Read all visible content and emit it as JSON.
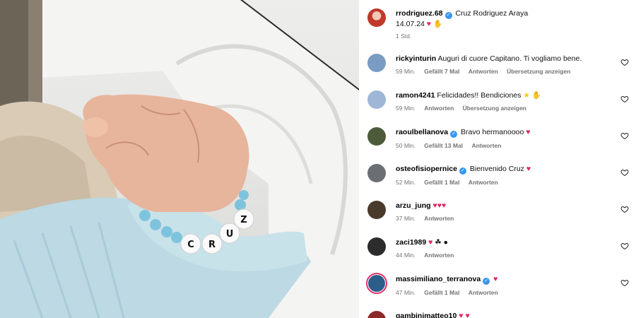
{
  "post": {
    "author": "rrodriguez.68",
    "caption": "Cruz Rodriguez Araya",
    "date_line": "14.07.24 ♥",
    "time": "1 Std.",
    "bracelet_text": "CRUZ"
  },
  "comments": [
    {
      "user": "rickyinturin",
      "verified": false,
      "text": "Auguri di cuore Capitano. Ti vogliamo bene.",
      "time": "59 Min.",
      "likes": "Gefällt 7 Mal",
      "reply": "Antworten",
      "translate": "Übersetzung anzeigen",
      "avatar_color": "#7a9cc4"
    },
    {
      "user": "ramon4241",
      "verified": false,
      "text": "Felicidades!! Bendiciones ⭐",
      "time": "59 Min.",
      "likes": "",
      "reply": "Antworten",
      "translate": "Übersetzung anzeigen",
      "avatar_color": "#9fb6d6"
    },
    {
      "user": "raoulbellanova",
      "verified": true,
      "text": "Bravo hermanoooo ♥",
      "time": "50 Min.",
      "likes": "Gefällt 13 Mal",
      "reply": "Antworten",
      "translate": "",
      "avatar_color": "#4d5b3a"
    },
    {
      "user": "osteofisiopernice",
      "verified": true,
      "text": "Bienvenido Cruz ♥",
      "time": "52 Min.",
      "likes": "Gefällt 1 Mal",
      "reply": "Antworten",
      "translate": "",
      "avatar_color": "#6b6e72"
    },
    {
      "user": "arzu_jung",
      "verified": false,
      "text": "♥♥♥",
      "time": "37 Min.",
      "likes": "",
      "reply": "Antworten",
      "translate": "",
      "avatar_color": "#4a3a2c"
    },
    {
      "user": "zaci1989",
      "verified": false,
      "text": "♥ ☘ ●",
      "time": "44 Min.",
      "likes": "",
      "reply": "Antworten",
      "translate": "",
      "avatar_color": "#2c2c2c"
    },
    {
      "user": "massimiliano_terranova",
      "verified": true,
      "text": "♥",
      "time": "47 Min.",
      "likes": "Gefällt 1 Mal",
      "reply": "Antworten",
      "translate": "",
      "avatar_color": "#2d5d8a"
    },
    {
      "user": "gambinimatteo10",
      "verified": false,
      "text": "♥ ♥",
      "time": "",
      "likes": "",
      "reply": "",
      "translate": "",
      "avatar_color": "#8a2a2a"
    }
  ],
  "colors": {
    "heart_red": "#e0245e",
    "verified_blue": "#3897f0",
    "star": "#f5c518"
  }
}
